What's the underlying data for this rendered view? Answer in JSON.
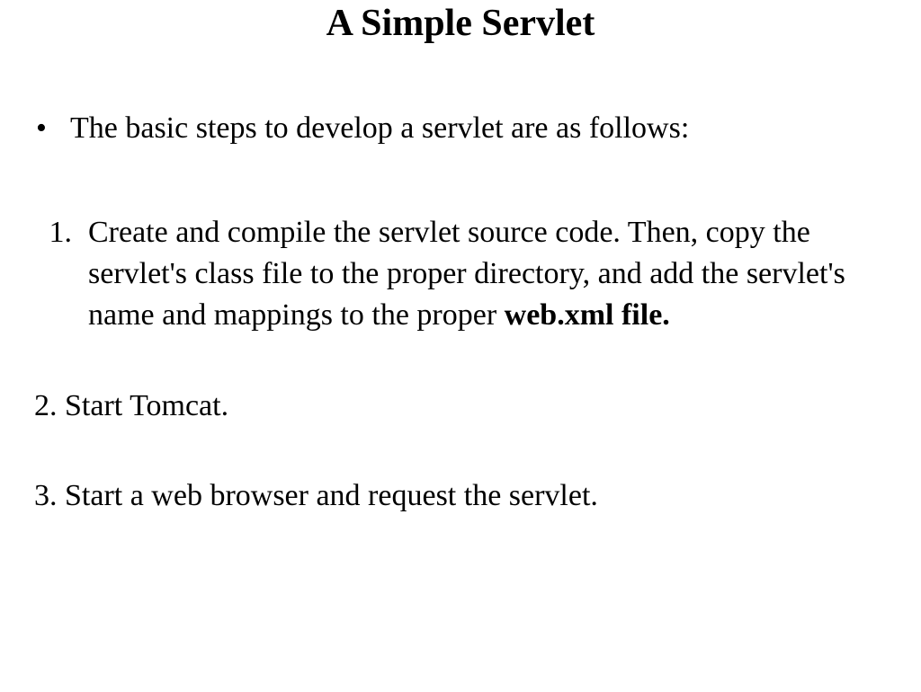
{
  "title": "A Simple Servlet",
  "intro": {
    "bullet": "•",
    "text": "The basic steps to develop a servlet are as follows:"
  },
  "steps": {
    "s1": {
      "num": "1.",
      "text_a": "Create and compile the servlet source code. Then, copy the servlet's class file to the proper directory, and add the servlet's name and mappings to the proper ",
      "text_bold": "web.xml file."
    },
    "s2": {
      "text": "2. Start Tomcat."
    },
    "s3": {
      "text": "3. Start a web browser and request the servlet."
    }
  }
}
